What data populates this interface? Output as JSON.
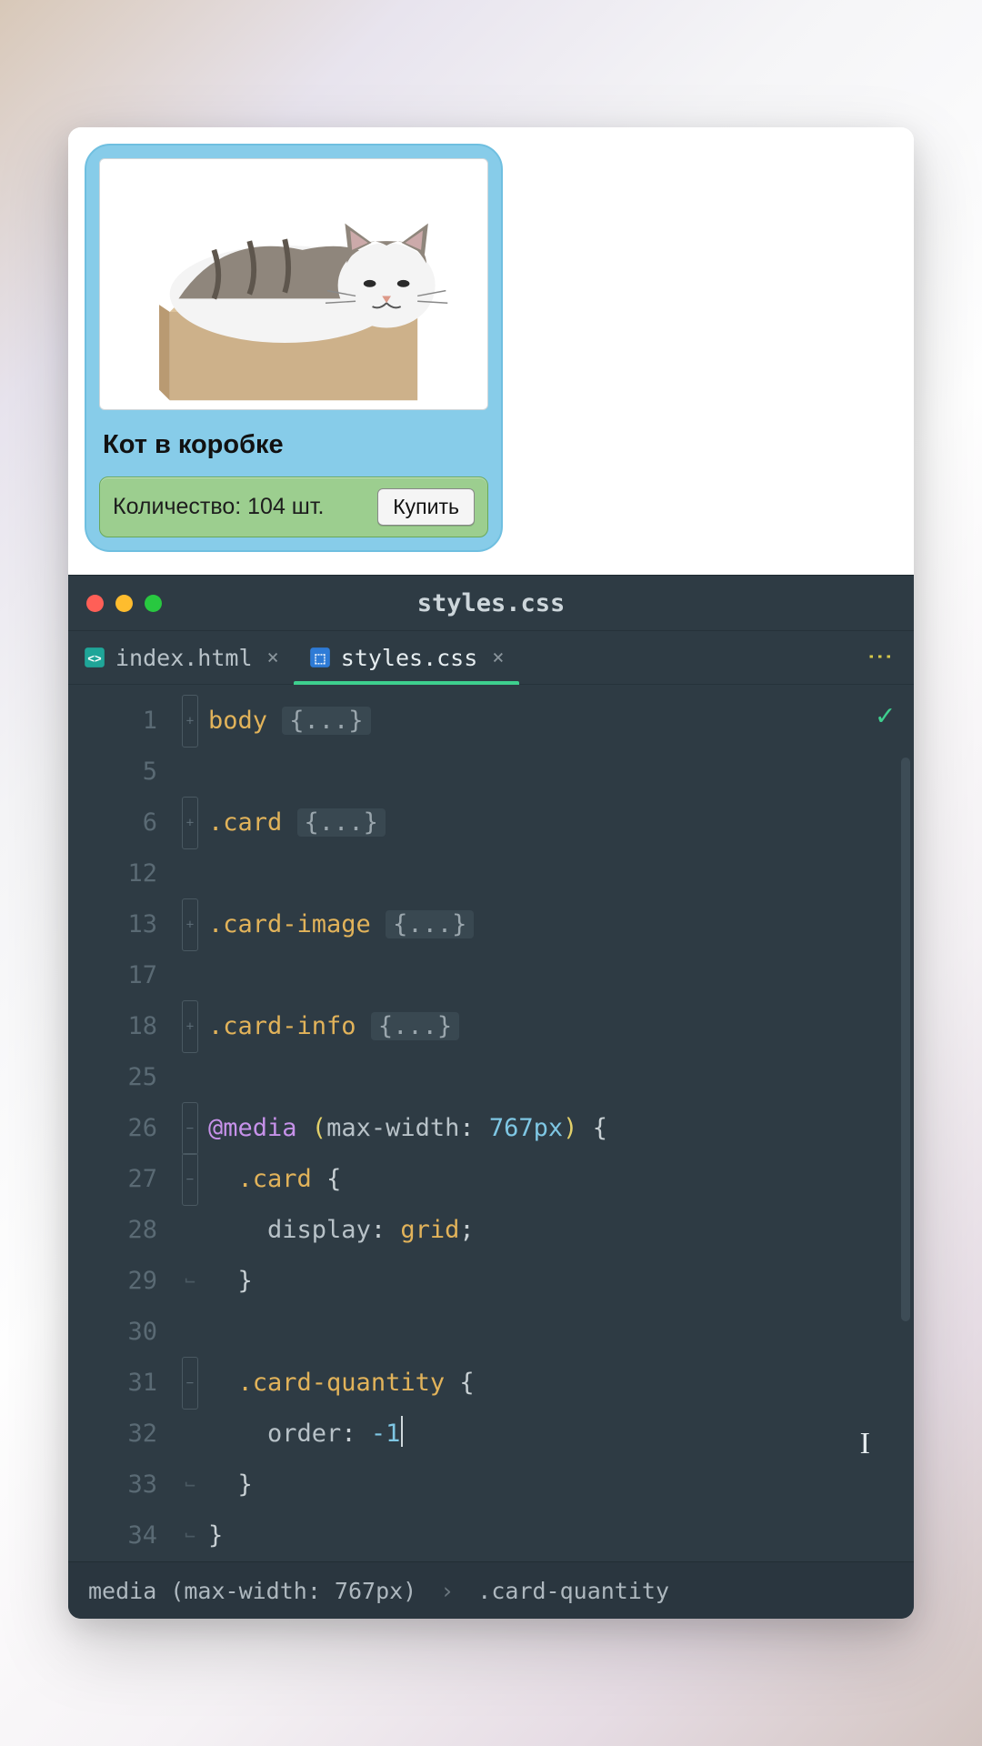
{
  "preview": {
    "card_title": "Кот в коробке",
    "quantity_label": "Количество: 104 шт.",
    "buy_label": "Купить"
  },
  "editor": {
    "window_title": "styles.css",
    "tabs": [
      {
        "label": "index.html",
        "icon": "html-icon",
        "active": false
      },
      {
        "label": "styles.css",
        "icon": "css-icon",
        "active": true
      }
    ],
    "kebab_glyph": "⋮",
    "status_ok": "✓",
    "line_numbers": [
      "1",
      "5",
      "6",
      "12",
      "13",
      "17",
      "18",
      "25",
      "26",
      "27",
      "28",
      "29",
      "30",
      "31",
      "32",
      "33",
      "34"
    ],
    "code_lines": [
      {
        "tokens": [
          {
            "t": "body ",
            "c": "tok-sel"
          },
          {
            "t": "{...}",
            "c": "tok-collapsed"
          }
        ],
        "fold": "+"
      },
      {
        "tokens": []
      },
      {
        "tokens": [
          {
            "t": ".card ",
            "c": "tok-sel"
          },
          {
            "t": "{...}",
            "c": "tok-collapsed"
          }
        ],
        "fold": "+"
      },
      {
        "tokens": []
      },
      {
        "tokens": [
          {
            "t": ".card-image ",
            "c": "tok-sel"
          },
          {
            "t": "{...}",
            "c": "tok-collapsed"
          }
        ],
        "fold": "+"
      },
      {
        "tokens": []
      },
      {
        "tokens": [
          {
            "t": ".card-info ",
            "c": "tok-sel"
          },
          {
            "t": "{...}",
            "c": "tok-collapsed"
          }
        ],
        "fold": "+"
      },
      {
        "tokens": []
      },
      {
        "tokens": [
          {
            "t": "@media ",
            "c": "tok-at"
          },
          {
            "t": "(",
            "c": "tok-paren"
          },
          {
            "t": "max-width",
            "c": "tok-prop"
          },
          {
            "t": ": ",
            "c": "tok-punc"
          },
          {
            "t": "767px",
            "c": "tok-num"
          },
          {
            "t": ") ",
            "c": "tok-paren"
          },
          {
            "t": "{",
            "c": "tok-punc"
          }
        ],
        "fold": "-"
      },
      {
        "tokens": [
          {
            "t": "  ",
            "c": ""
          },
          {
            "t": ".card ",
            "c": "tok-sel"
          },
          {
            "t": "{",
            "c": "tok-punc"
          }
        ],
        "fold": "-"
      },
      {
        "tokens": [
          {
            "t": "    ",
            "c": ""
          },
          {
            "t": "display",
            "c": "tok-prop"
          },
          {
            "t": ": ",
            "c": "tok-punc"
          },
          {
            "t": "grid",
            "c": "tok-kw"
          },
          {
            "t": ";",
            "c": "tok-punc"
          }
        ]
      },
      {
        "tokens": [
          {
            "t": "  ",
            "c": ""
          },
          {
            "t": "}",
            "c": "tok-punc"
          }
        ],
        "fold": "c"
      },
      {
        "tokens": []
      },
      {
        "tokens": [
          {
            "t": "  ",
            "c": ""
          },
          {
            "t": ".card-quantity ",
            "c": "tok-sel"
          },
          {
            "t": "{",
            "c": "tok-punc"
          }
        ],
        "fold": "-"
      },
      {
        "tokens": [
          {
            "t": "    ",
            "c": ""
          },
          {
            "t": "order",
            "c": "tok-prop"
          },
          {
            "t": ": ",
            "c": "tok-punc"
          },
          {
            "t": "-1",
            "c": "tok-num"
          }
        ],
        "caret": true
      },
      {
        "tokens": [
          {
            "t": "  ",
            "c": ""
          },
          {
            "t": "}",
            "c": "tok-punc"
          }
        ],
        "fold": "c"
      },
      {
        "tokens": [
          {
            "t": "}",
            "c": "tok-punc"
          }
        ],
        "fold": "c"
      }
    ],
    "breadcrumb": [
      "media (max-width: 767px)",
      "›",
      ".card-quantity"
    ]
  }
}
